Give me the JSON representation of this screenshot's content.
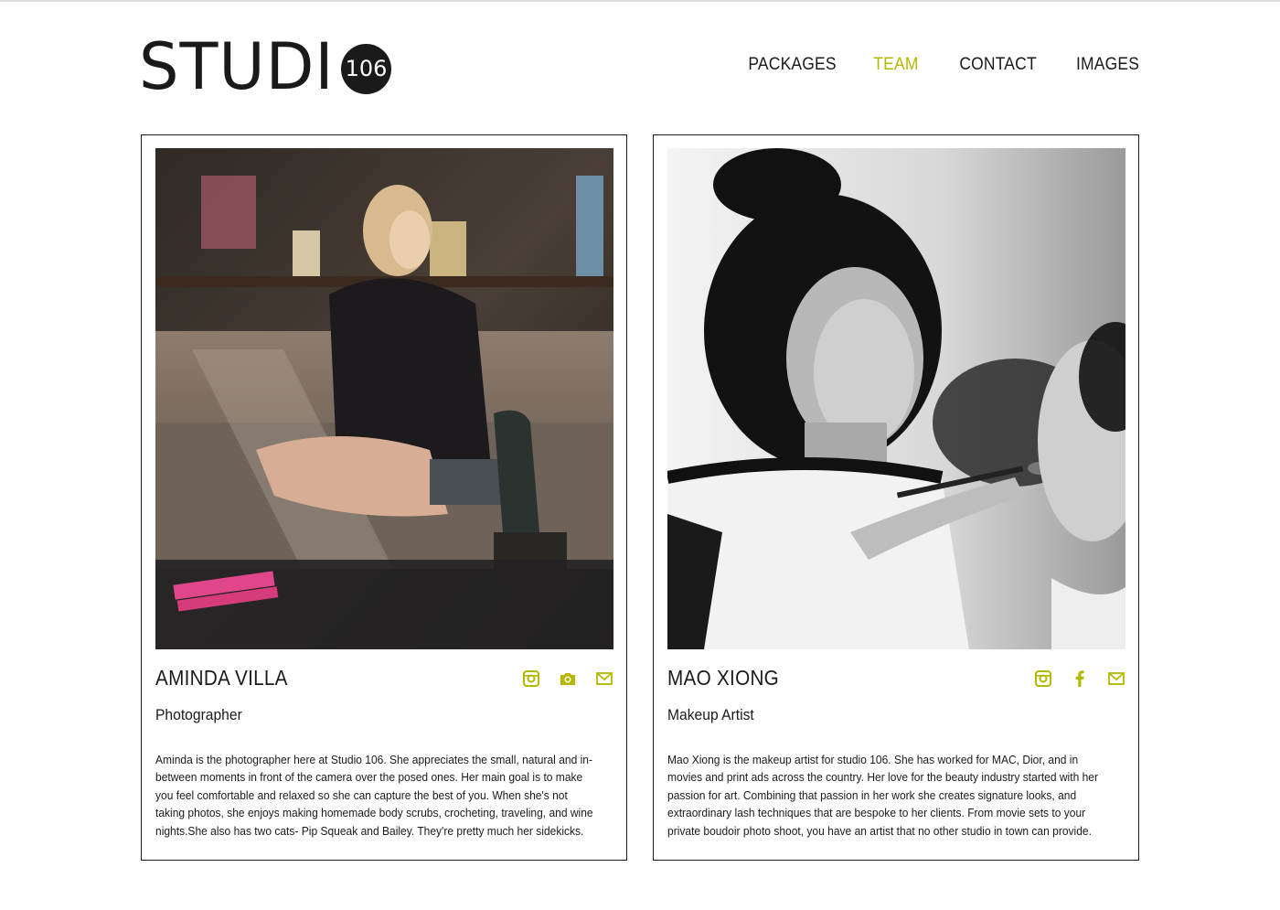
{
  "brand": {
    "logo_text": "STUDI",
    "logo_badge": "106",
    "accent_color": "#b5b800"
  },
  "nav": {
    "items": [
      {
        "label": "PACKAGES",
        "active": false
      },
      {
        "label": "TEAM",
        "active": true
      },
      {
        "label": "CONTACT",
        "active": false
      },
      {
        "label": "IMAGES",
        "active": false
      }
    ]
  },
  "team": [
    {
      "name": "AMINDA VILLA",
      "role": "Photographer",
      "bio": "Aminda is the photographer here at Studio 106. She appreciates the small, natural and in-between moments in front of the camera over the posed ones. Her main goal is to make you feel comfortable and relaxed so she can capture the best of you. When she's not taking photos, she enjoys making homemade body scrubs, crocheting, traveling, and wine nights.She also has two cats- Pip Squeak and Bailey. They're pretty much her sidekicks.",
      "socials": [
        "instagram-icon",
        "camera-icon",
        "mail-icon"
      ]
    },
    {
      "name": "MAO XIONG",
      "role": "Makeup Artist",
      "bio": "Mao Xiong is the makeup artist for studio 106. She has worked for MAC, Dior, and in movies and print ads across the country. Her love for the beauty industry started with her passion for art. Combining that passion in her work she creates signature looks, and extraordinary lash techniques that are bespoke to her clients. From movie sets to your private boudoir photo shoot, you have an artist that no other studio in town can provide.",
      "socials": [
        "instagram-icon",
        "facebook-icon",
        "mail-icon"
      ]
    }
  ]
}
